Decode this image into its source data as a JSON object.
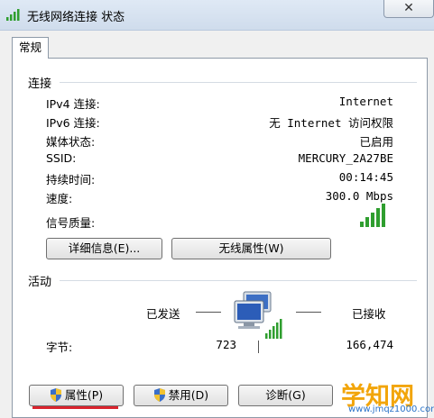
{
  "window": {
    "title": "无线网络连接 状态",
    "close_label": "✕"
  },
  "tab": {
    "label": "常规"
  },
  "connection": {
    "section_title": "连接",
    "rows": [
      {
        "label": "IPv4 连接:",
        "value": "Internet"
      },
      {
        "label": "IPv6 连接:",
        "value": "无 Internet 访问权限"
      },
      {
        "label": "媒体状态:",
        "value": "已启用"
      },
      {
        "label": "SSID:",
        "value": "MERCURY_2A27BE"
      },
      {
        "label": "持续时间:",
        "value": "00:14:45"
      },
      {
        "label": "速度:",
        "value": "300.0 Mbps"
      }
    ],
    "signal_label": "信号质量:",
    "signal_bars_lit": 5,
    "details_button": "详细信息(E)...",
    "wireless_props_button": "无线属性(W)"
  },
  "activity": {
    "section_title": "活动",
    "sent_label": "已发送",
    "received_label": "已接收",
    "bytes_label": "字节:",
    "bytes_sent": "723",
    "bytes_received": "166,474"
  },
  "footer": {
    "properties_button": "属性(P)",
    "disable_button": "禁用(D)",
    "diagnose_button": "诊断(G)"
  },
  "watermark": {
    "main": "学知网",
    "sub": "www.jmqz1000.com"
  },
  "colors": {
    "signal_green": "#2f9e2f",
    "accent_red": "#d9232d",
    "watermark_orange": "#f2a50a",
    "watermark_blue": "#2a73c8"
  }
}
